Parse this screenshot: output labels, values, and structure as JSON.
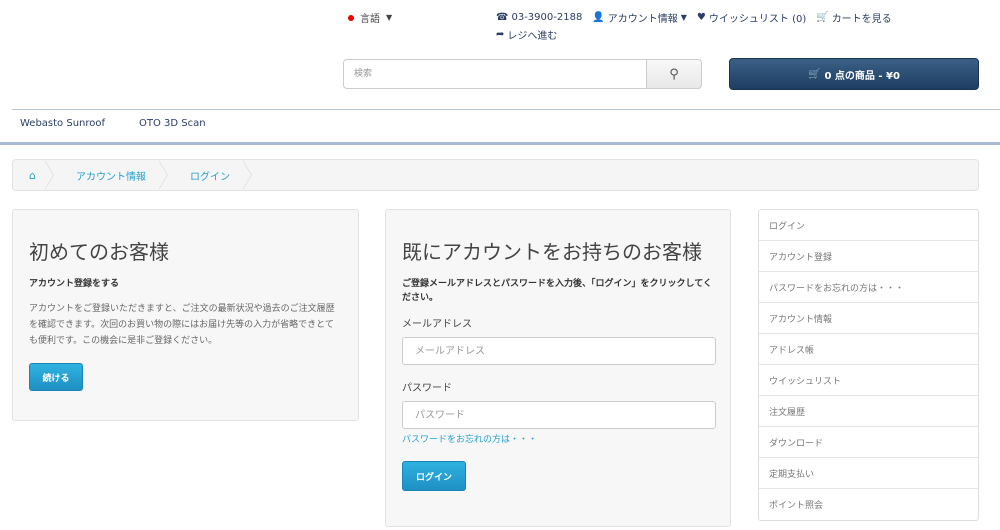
{
  "header": {
    "language": "言語",
    "phone": "03-3900-2188",
    "account": "アカウント情報",
    "wishlist": "ウイッシュリスト (0)",
    "cart_link": "カートを見る",
    "checkout": "レジへ進む"
  },
  "search": {
    "placeholder": "検索"
  },
  "cart": {
    "label": "0 点の商品 - ¥0"
  },
  "nav": {
    "items": [
      "Webasto Sunroof",
      "OTO 3D Scan"
    ]
  },
  "breadcrumb": {
    "items": [
      "アカウント情報",
      "ログイン"
    ]
  },
  "new_customer": {
    "title": "初めてのお客様",
    "subtitle": "アカウント登録をする",
    "text": "アカウントをご登録いただきますと、ご注文の最新状況や過去のご注文履歴を確認できます。次回のお買い物の際にはお届け先等の入力が省略できとても便利です。この機会に是非ご登録ください。",
    "continue_label": "続ける"
  },
  "returning_customer": {
    "title": "既にアカウントをお持ちのお客様",
    "subtitle": "ご登録メールアドレスとパスワードを入力後、「ログイン」をクリックしてください。",
    "email_label": "メールアドレス",
    "email_placeholder": "メールアドレス",
    "password_label": "パスワード",
    "password_placeholder": "パスワード",
    "forgot_label": "パスワードをお忘れの方は・・・",
    "login_label": "ログイン"
  },
  "sidebar": {
    "items": [
      "ログイン",
      "アカウント登録",
      "パスワードをお忘れの方は・・・",
      "アカウント情報",
      "アドレス帳",
      "ウイッシュリスト",
      "注文履歴",
      "ダウンロード",
      "定期支払い",
      "ポイント照会"
    ]
  },
  "colors": {
    "accent": "#23a1d1",
    "cart_button": "#2a4c72",
    "link": "#2a3d66"
  }
}
